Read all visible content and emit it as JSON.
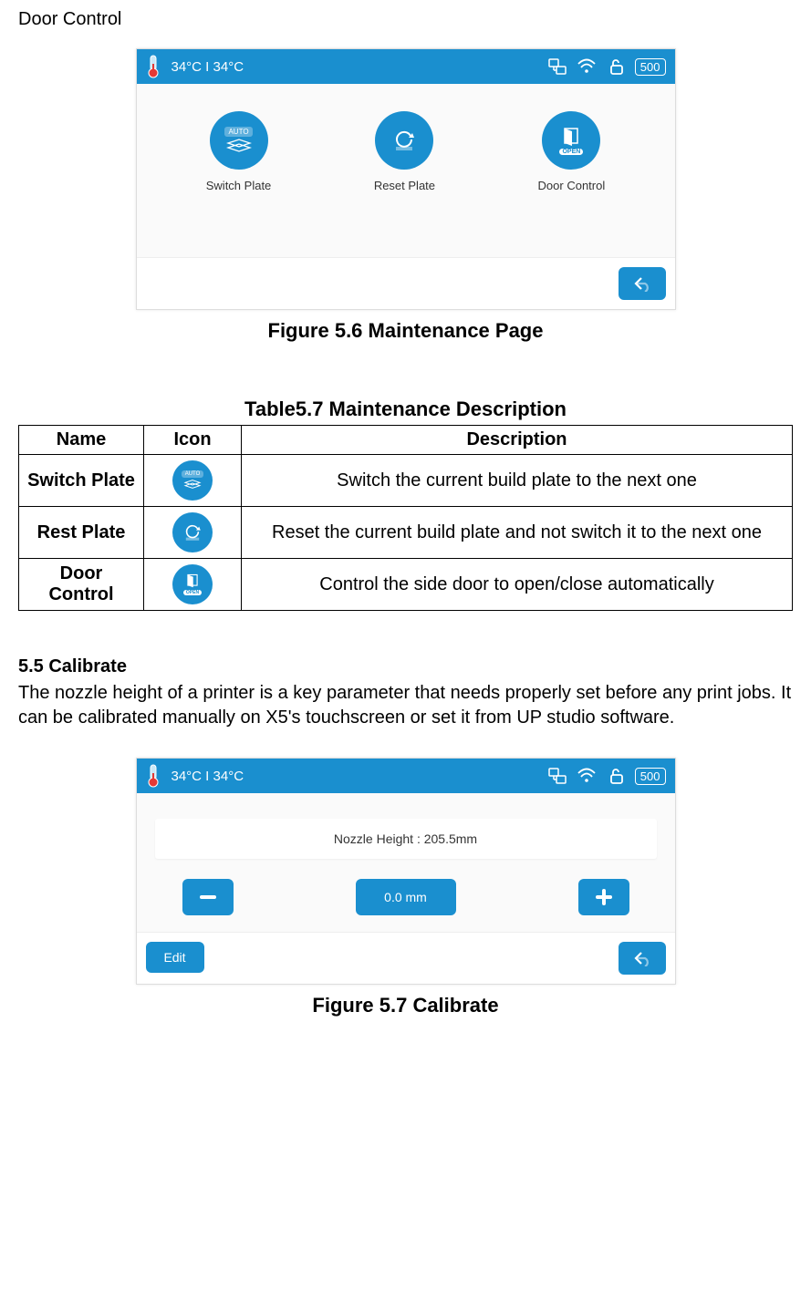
{
  "topLabel": "Door Control",
  "statusBar": {
    "temp": "34°C I 34°C",
    "badge": "500"
  },
  "maintenance": {
    "tiles": {
      "switch": "Switch Plate",
      "reset": "Reset Plate",
      "door": "Door Control"
    },
    "autoBadge": "AUTO",
    "openBadge": "OPEN"
  },
  "fig56": "Figure 5.6 Maintenance Page",
  "table57": {
    "caption": "Table5.7 Maintenance Description",
    "headers": {
      "name": "Name",
      "icon": "Icon",
      "desc": "Description"
    },
    "rows": [
      {
        "name": "Switch Plate",
        "desc": "Switch the current build plate to the next one"
      },
      {
        "name": "Rest Plate",
        "desc": "Reset the current build plate and not switch it to the next one"
      },
      {
        "name": "Door Control",
        "desc": "Control the side door to open/close automatically"
      }
    ],
    "autoBadge": "AUTO",
    "openBadge": "OPEN"
  },
  "calibrate": {
    "heading": "5.5 Calibrate",
    "body": "The nozzle height of a printer is a key parameter that needs properly set before any print jobs. It can be calibrated manually on X5's touchscreen or set it from UP studio software.",
    "nozzleLabel": "Nozzle Height :  205.5mm",
    "currentValue": "0.0 mm",
    "editLabel": "Edit"
  },
  "fig57": "Figure 5.7 Calibrate"
}
